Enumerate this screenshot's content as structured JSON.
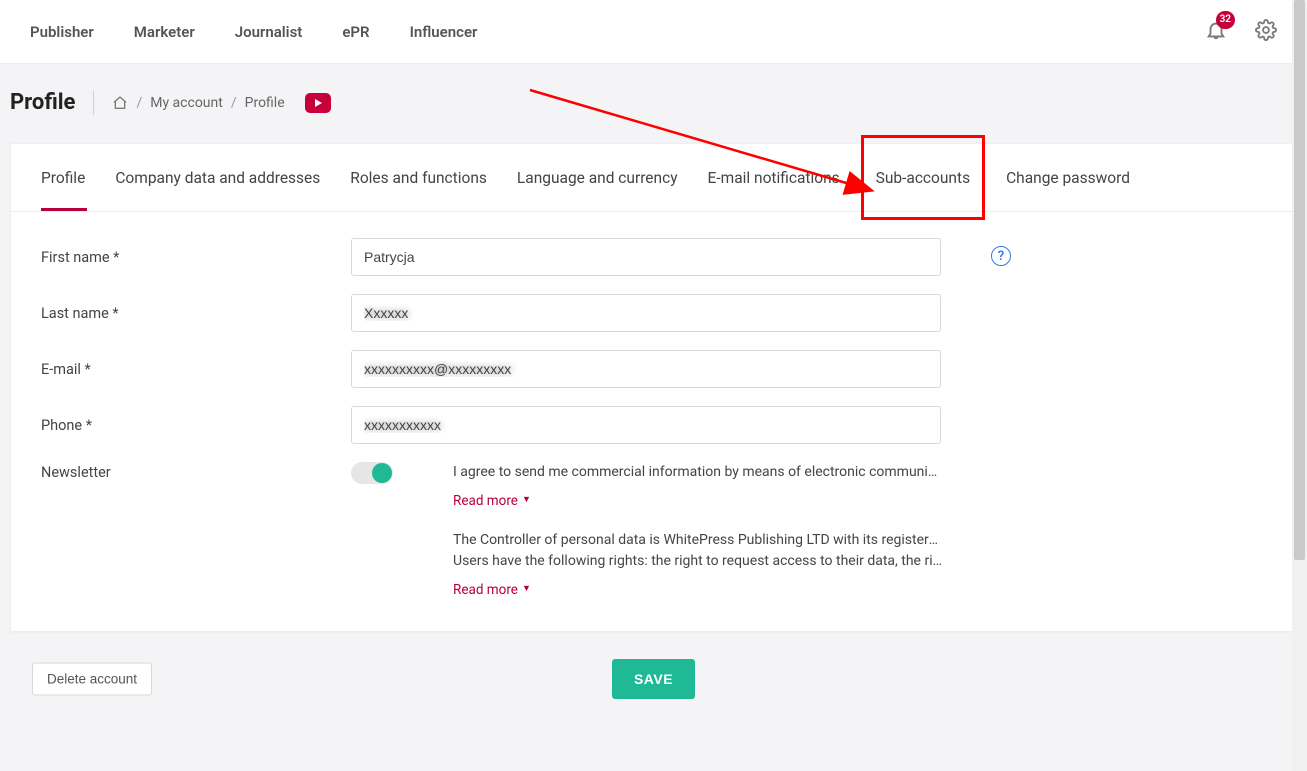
{
  "nav": {
    "links": [
      "Publisher",
      "Marketer",
      "Journalist",
      "ePR",
      "Influencer"
    ],
    "notification_count": "32"
  },
  "header": {
    "title": "Profile",
    "breadcrumb": {
      "my_account": "My account",
      "profile": "Profile"
    }
  },
  "tabs": [
    "Profile",
    "Company data and addresses",
    "Roles and functions",
    "Language and currency",
    "E-mail notifications",
    "Sub-accounts",
    "Change password"
  ],
  "form": {
    "first_name_label": "First name *",
    "first_name_value": "Patrycja",
    "last_name_label": "Last name *",
    "last_name_value": "Xxxxxx",
    "email_label": "E-mail *",
    "email_value": "xxxxxxxxxx@xxxxxxxxx",
    "phone_label": "Phone *",
    "phone_value": "xxxxxxxxxxx",
    "newsletter_label": "Newsletter",
    "newsletter_consent": "I agree to send me commercial information by means of electronic communicatio…",
    "read_more": "Read more",
    "controller_1": "The Controller of personal data is WhitePress Publishing LTD  with its registered o…",
    "controller_2": "Users have the following rights: the right to request access to their data, the right …"
  },
  "actions": {
    "save": "SAVE",
    "delete": "Delete account"
  },
  "help_icon_text": "?"
}
